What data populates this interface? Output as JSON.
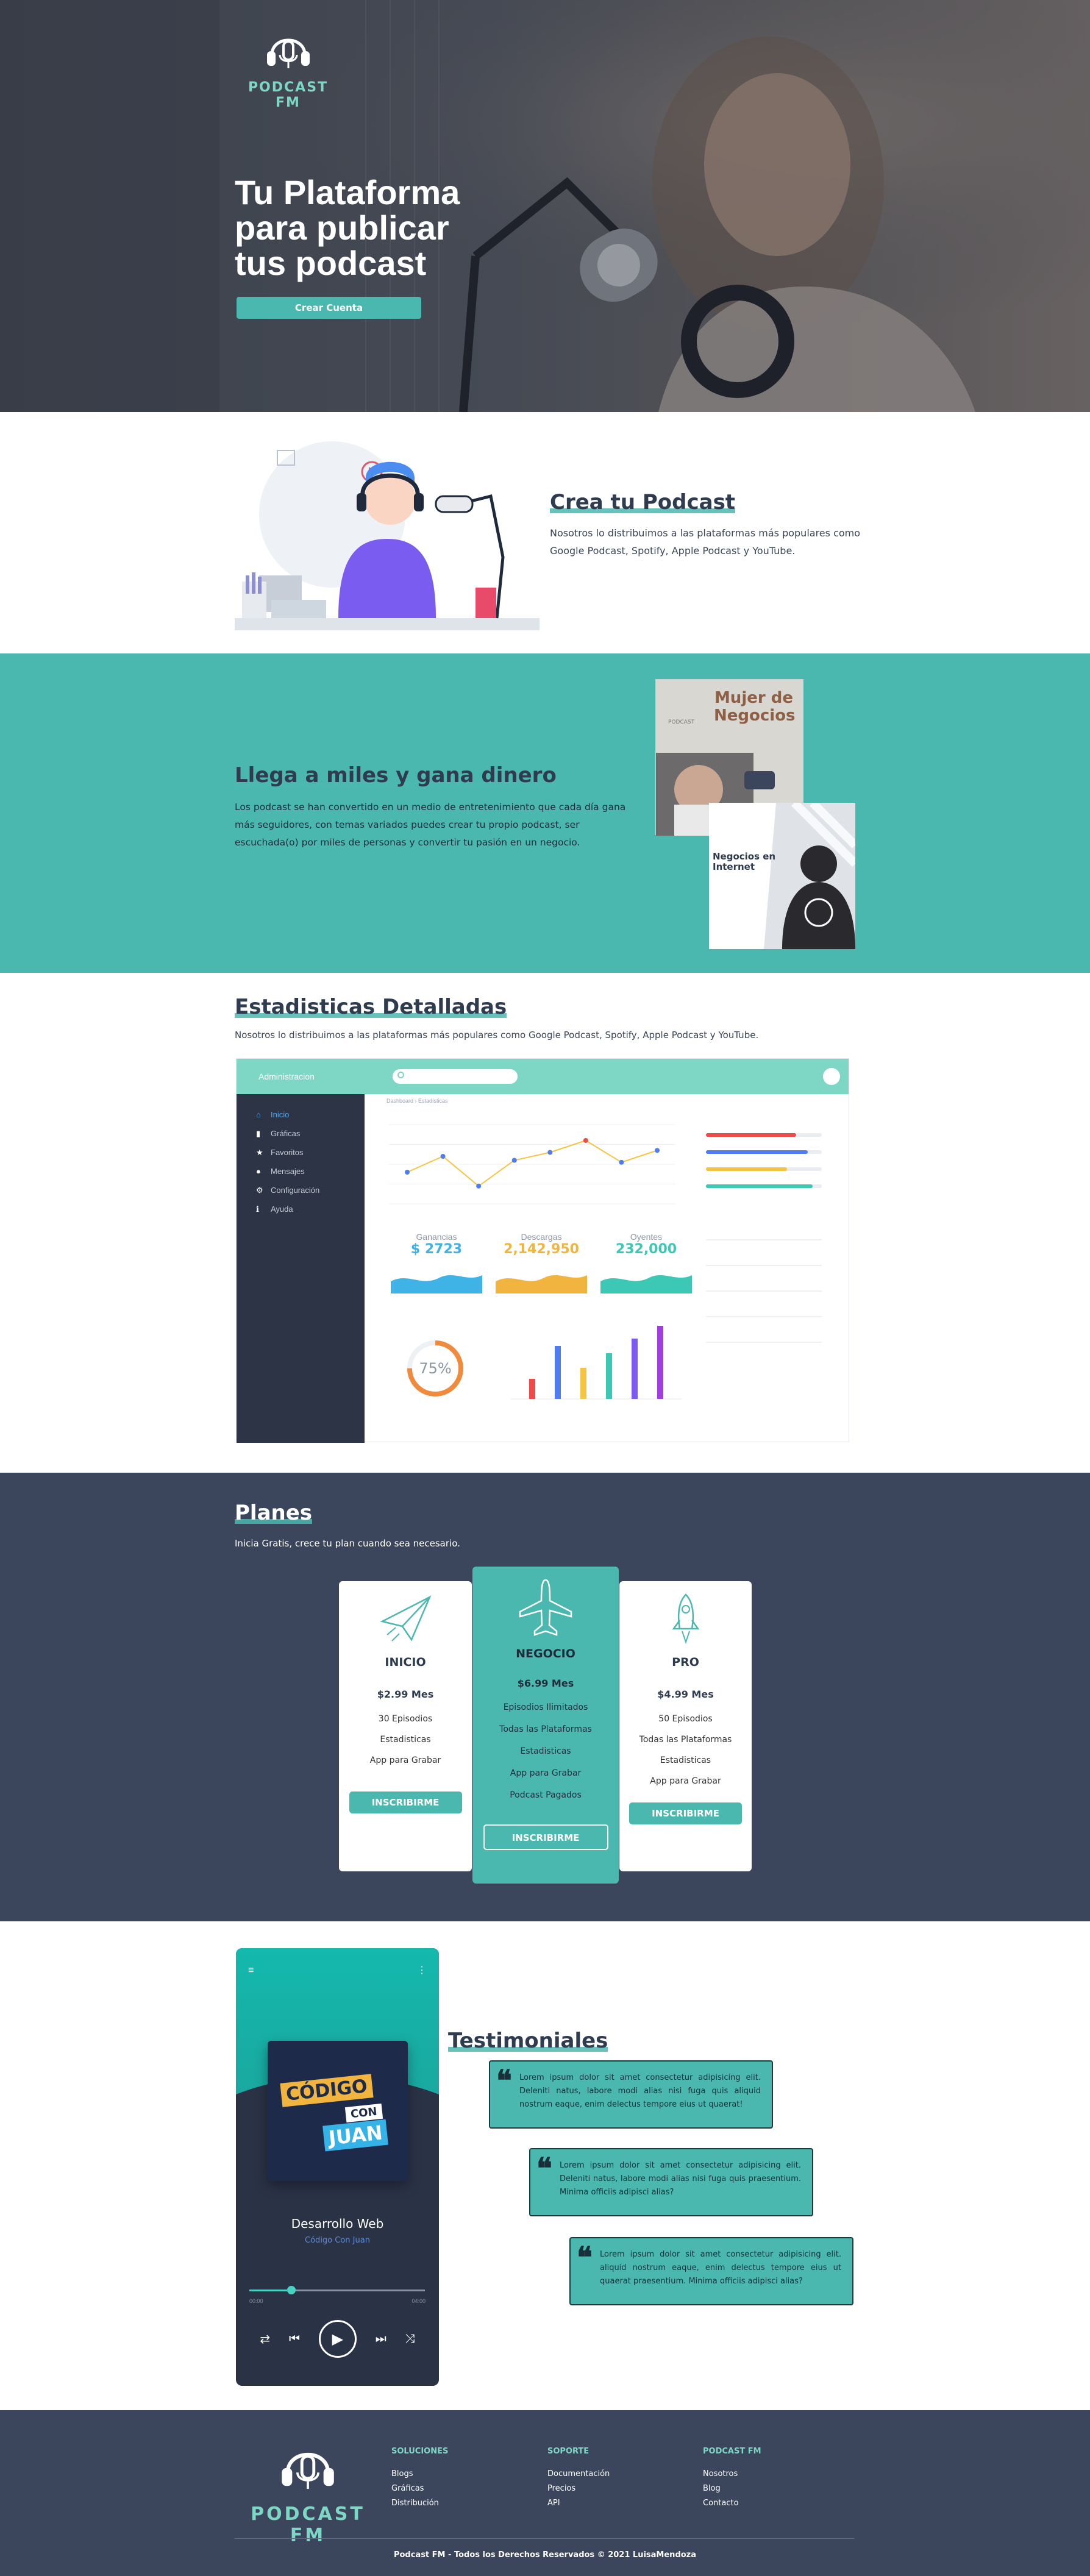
{
  "brand": {
    "name": "PODCAST FM",
    "accent": "#4bb8b0",
    "accent_light": "#7ed6c5",
    "dark": "#3b465c"
  },
  "hero": {
    "title": "Tu Plataforma para publicar tus podcast",
    "cta": "Crear Cuenta"
  },
  "create": {
    "title": "Crea tu Podcast",
    "text": "Nosotros lo distribuimos a las plataformas más populares como Google Podcast, Spotify, Apple Podcast y YouTube."
  },
  "reach": {
    "title": "Llega a miles y gana dinero",
    "text": "Los podcast se han convertido en un medio de entretenimiento que cada día gana más seguidores, con temas variados puedes crear tu propio podcast, ser escuchada(o) por miles de personas y convertir tu pasión en un negocio.",
    "card1": "Mujer de Negocios",
    "card2": "Negocios en Internet"
  },
  "stats": {
    "title": "Estadisticas Detalladas",
    "text": "Nosotros lo distribuimos a las plataformas más populares como Google Podcast, Spotify, Apple Podcast y YouTube.",
    "dashboard": {
      "brand": "Administracion",
      "breadcrumb": "Dashboard › Estadísticas",
      "menu": [
        {
          "label": "Inicio",
          "icon": "home-icon"
        },
        {
          "label": "Gráficas",
          "icon": "chart-icon"
        },
        {
          "label": "Favoritos",
          "icon": "star-icon"
        },
        {
          "label": "Mensajes",
          "icon": "message-icon"
        },
        {
          "label": "Configuración",
          "icon": "gear-icon"
        },
        {
          "label": "Ayuda",
          "icon": "info-icon"
        }
      ],
      "metrics": [
        {
          "label": "Ganancias",
          "value": "$ 2723",
          "color": "#3fb2e6"
        },
        {
          "label": "Descargas",
          "value": "2,142,950",
          "color": "#f1b53f"
        },
        {
          "label": "Oyentes",
          "value": "232,000",
          "color": "#3cc8b4"
        }
      ],
      "donut": {
        "value": "75%",
        "percent": 0.75
      }
    }
  },
  "chart_data": {
    "type": "line",
    "x": [
      1,
      2,
      3,
      4,
      5,
      6,
      7,
      8
    ],
    "values": [
      32,
      48,
      18,
      44,
      52,
      64,
      42,
      54
    ],
    "bars": {
      "type": "bar",
      "values": [
        22,
        58,
        34,
        50,
        66,
        80
      ],
      "colors": [
        "#ef4b4b",
        "#4f7df0",
        "#f5c443",
        "#3cc8b4",
        "#7c5cf0",
        "#a23ee0"
      ]
    }
  },
  "plans": {
    "title": "Planes",
    "subtitle": "Inicia Gratis, crece tu plan cuando sea necesario.",
    "items": [
      {
        "name": "INICIO",
        "price": "$2.99 Mes",
        "features": [
          "30 Episodios",
          "Estadisticas",
          "App para Grabar"
        ],
        "cta": "INSCRIBIRME"
      },
      {
        "name": "NEGOCIO",
        "price": "$6.99 Mes",
        "features": [
          "Episodios Ilimitados",
          "Todas las Plataformas",
          "Estadisticas",
          "App para Grabar",
          "Podcast Pagados"
        ],
        "cta": "INSCRIBIRME"
      },
      {
        "name": "PRO",
        "price": "$4.99 Mes",
        "features": [
          "50 Episodios",
          "Todas las Plataformas",
          "Estadisticas",
          "App para Grabar"
        ],
        "cta": "INSCRIBIRME"
      }
    ]
  },
  "testimonials": {
    "title": "Testimoniales",
    "player": {
      "album_line1": "CÓDIGO",
      "album_line2": "CON",
      "album_line3": "JUAN",
      "track": "Desarrollo Web",
      "artist": "Código Con Juan",
      "elapsed": "00:00",
      "total": "04:00"
    },
    "quotes": [
      "Lorem ipsum dolor sit amet consectetur adipisicing elit. Deleniti natus, labore modi alias nisi fuga quis aliquid nostrum eaque, enim delectus tempore eius ut quaerat!",
      "Lorem ipsum dolor sit amet consectetur adipisicing elit. Deleniti natus, labore modi alias nisi fuga quis praesentium. Minima officiis adipisci alias?",
      "Lorem ipsum dolor sit amet consectetur adipisicing elit. aliquid nostrum eaque, enim delectus tempore eius ut quaerat praesentium. Minima officiis adipisci alias?"
    ]
  },
  "footer": {
    "columns": [
      {
        "title": "SOLUCIONES",
        "links": [
          "Blogs",
          "Gráficas",
          "Distribución"
        ]
      },
      {
        "title": "SOPORTE",
        "links": [
          "Documentación",
          "Precios",
          "API"
        ]
      },
      {
        "title": "PODCAST FM",
        "links": [
          "Nosotros",
          "Blog",
          "Contacto"
        ]
      }
    ],
    "copyright": "Podcast FM - Todos los Derechos Reservados © 2021 LuisaMendoza"
  }
}
